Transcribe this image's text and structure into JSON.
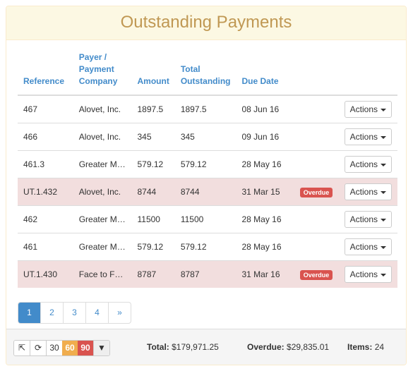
{
  "title": "Outstanding Payments",
  "columns": [
    "Reference",
    "Payer / Payment Company",
    "Amount",
    "Total Outstanding",
    "Due Date"
  ],
  "rows": [
    {
      "ref": "467",
      "payer": "Alovet, Inc.",
      "amount": "1897.5",
      "total": "1897.5",
      "due": "08 Jun 16",
      "badge": ""
    },
    {
      "ref": "466",
      "payer": "Alovet, Inc.",
      "amount": "345",
      "total": "345",
      "due": "09 Jun 16",
      "badge": ""
    },
    {
      "ref": "461.3",
      "payer": "Greater M…",
      "amount": "579.12",
      "total": "579.12",
      "due": "28 May 16",
      "badge": ""
    },
    {
      "ref": "UT.1.432",
      "payer": "Alovet, Inc.",
      "amount": "8744",
      "total": "8744",
      "due": "31 Mar 15",
      "badge": "Overdue"
    },
    {
      "ref": "462",
      "payer": "Greater M…",
      "amount": "11500",
      "total": "11500",
      "due": "28 May 16",
      "badge": ""
    },
    {
      "ref": "461",
      "payer": "Greater M…",
      "amount": "579.12",
      "total": "579.12",
      "due": "28 May 16",
      "badge": ""
    },
    {
      "ref": "UT.1.430",
      "payer": "Face to F…",
      "amount": "8787",
      "total": "8787",
      "due": "31 Mar 16",
      "badge": "Overdue"
    }
  ],
  "actions_label": "Actions",
  "pagination": [
    "1",
    "2",
    "3",
    "4",
    "»"
  ],
  "toolbar": {
    "sizes": [
      "30",
      "60",
      "90"
    ]
  },
  "summary": {
    "total_label": "Total:",
    "total": "$179,971.25",
    "overdue_label": "Overdue:",
    "overdue": "$29,835.01",
    "items_label": "Items:",
    "items": "24"
  }
}
